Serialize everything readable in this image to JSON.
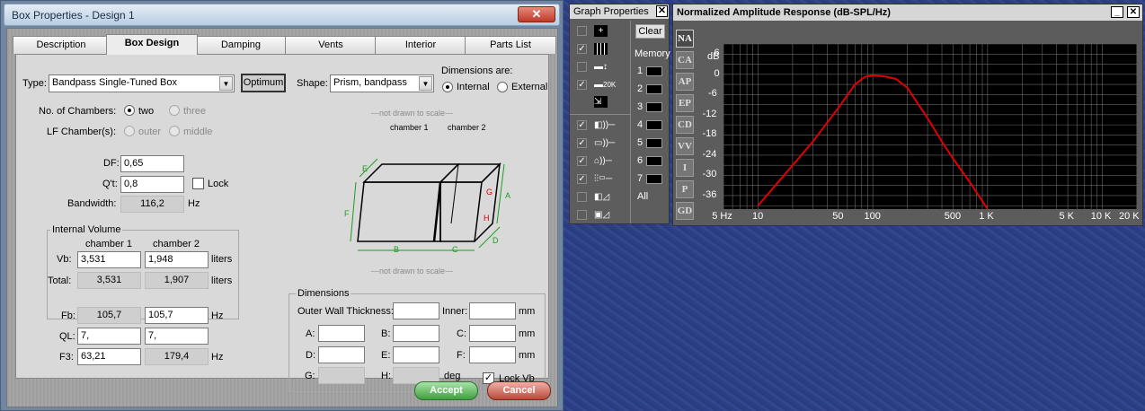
{
  "dialog": {
    "title": "Box Properties - Design 1",
    "close": "✕",
    "tabs": [
      "Description",
      "Box Design",
      "Damping",
      "Vents",
      "Interior",
      "Parts List"
    ],
    "active_tab": "Box Design",
    "type_label": "Type:",
    "type_value": "Bandpass Single-Tuned Box",
    "optimum": "Optimum",
    "shape_label": "Shape:",
    "shape_value": "Prism, bandpass",
    "dims_are": "Dimensions are:",
    "internal": "Internal",
    "external": "External",
    "chambers_label": "No. of Chambers:",
    "two": "two",
    "three": "three",
    "lf_label": "LF Chamber(s):",
    "outer": "outer",
    "middle": "middle",
    "df_label": "DF:",
    "df_value": "0,65",
    "qt_label": "Q't:",
    "qt_value": "0,8",
    "lock": "Lock",
    "bw_label": "Bandwidth:",
    "bw_value": "116,2",
    "hz": "Hz",
    "iv_title": "Internal Volume",
    "ch1": "chamber 1",
    "ch2": "chamber 2",
    "vb_label": "Vb:",
    "vb1": "3,531",
    "vb2": "1,948",
    "liters": "liters",
    "total_label": "Total:",
    "tot1": "3,531",
    "tot2": "1,907",
    "fb_label": "Fb:",
    "fb1": "105,7",
    "fb2": "105,7",
    "ql_label": "QL:",
    "ql1": "7,",
    "ql2": "7,",
    "f3_label": "F3:",
    "f3_1": "63,21",
    "f3_2": "179,4",
    "ndts": "---not drawn to scale---",
    "diag_ch1": "chamber 1",
    "diag_ch2": "chamber 2",
    "diag": {
      "E": "E",
      "F": "F",
      "B": "B",
      "C": "C",
      "D": "D",
      "A": "A",
      "G": "G",
      "H": "H"
    },
    "dims_title": "Dimensions",
    "owt": "Outer Wall Thickness:",
    "inner": "Inner:",
    "mm": "mm",
    "A": "A:",
    "B": "B:",
    "C": "C:",
    "D": "D:",
    "E": "E:",
    "F": "F:",
    "G": "G:",
    "H": "H:",
    "deg": "deg",
    "lockvb": "Lock Vb",
    "accept": "Accept",
    "cancel": "Cancel"
  },
  "graph_props": {
    "title": "Graph Properties",
    "close": "✕",
    "clear": "Clear",
    "memory": "Memory",
    "mems": [
      "1",
      "2",
      "3",
      "4",
      "5",
      "6",
      "7"
    ],
    "all": "All",
    "twentyk": "20K"
  },
  "graph": {
    "title": "Normalized Amplitude Response (dB-SPL/Hz)",
    "min_btn": "_",
    "max_btn": "□",
    "close_btn": "✕",
    "side_buttons": [
      "NA",
      "CA",
      "AP",
      "EP",
      "CD",
      "VV",
      "I",
      "P",
      "GD"
    ],
    "active_side": "NA",
    "db_unit": "dB"
  },
  "chart_data": {
    "type": "line",
    "title": "Normalized Amplitude Response (dB-SPL/Hz)",
    "x_scale": "log",
    "xlim": [
      5,
      20000
    ],
    "ylim": [
      -40,
      9
    ],
    "yunit": "dB",
    "x_ticks": [
      "5 Hz",
      "10",
      "50",
      "100",
      "500",
      "1 K",
      "5 K",
      "10 K",
      "20 K"
    ],
    "y_ticks": [
      "6",
      "0",
      "-6",
      "-12",
      "-18",
      "-24",
      "-30",
      "-36"
    ],
    "grid": true,
    "series": [
      {
        "color": "#e00000",
        "x": [
          10,
          20,
          30,
          50,
          70,
          85,
          100,
          130,
          160,
          200,
          250,
          300,
          400,
          500,
          700,
          1000
        ],
        "y": [
          -39,
          -27,
          -20,
          -10,
          -3,
          -0.8,
          -0.3,
          -0.7,
          -1.4,
          -4,
          -9,
          -13,
          -20,
          -25,
          -32,
          -40
        ]
      }
    ]
  }
}
